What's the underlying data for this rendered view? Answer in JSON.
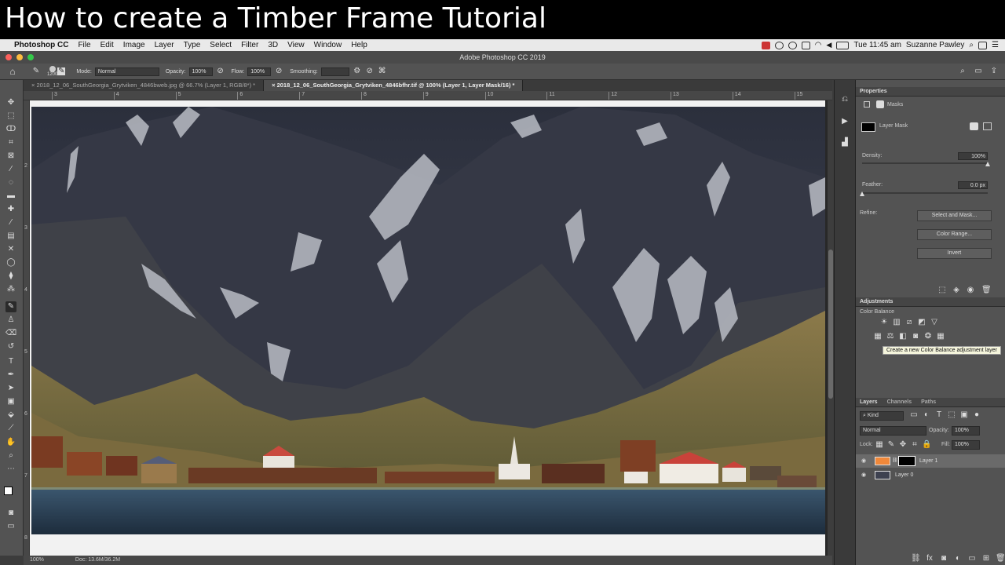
{
  "banner": {
    "title": "How to create a Timber Frame Tutorial"
  },
  "macbar": {
    "app": "Photoshop CC",
    "menus": [
      "File",
      "Edit",
      "Image",
      "Layer",
      "Type",
      "Select",
      "Filter",
      "3D",
      "View",
      "Window",
      "Help"
    ],
    "clock": "Tue 11:45 am",
    "user": "Suzanne Pawley"
  },
  "window": {
    "title": "Adobe Photoshop CC 2019"
  },
  "options": {
    "brush_size": "1200",
    "mode_label": "Mode:",
    "mode_value": "Normal",
    "opacity_label": "Opacity:",
    "opacity_value": "100%",
    "flow_label": "Flow:",
    "flow_value": "100%",
    "smoothing_label": "Smoothing:"
  },
  "tabs": [
    {
      "label": "2018_12_06_SouthGeorgia_Grytviken_4846bweb.jpg @ 66.7% (Layer 1, RGB/8*) *"
    },
    {
      "label": "2018_12_06_SouthGeorgia_Grytviken_4846bfhr.tif @ 100% (Layer 1, Layer Mask/16) *"
    }
  ],
  "ruler_top": [
    "3",
    "4",
    "5",
    "6",
    "7",
    "8",
    "9",
    "10",
    "11",
    "12",
    "13",
    "14",
    "15"
  ],
  "ruler_left": [
    "2",
    "3",
    "4",
    "5",
    "6",
    "7",
    "8"
  ],
  "status": {
    "zoom": "100%",
    "doc": "Doc: 13.6M/36.2M"
  },
  "properties": {
    "header": "Properties",
    "masks_label": "Masks",
    "layer_mask_label": "Layer Mask",
    "density_label": "Density:",
    "density_value": "100%",
    "density_fraction": 1.0,
    "feather_label": "Feather:",
    "feather_value": "0.0 px",
    "feather_fraction": 0.0,
    "refine_label": "Refine:",
    "select_mask_button": "Select and Mask...",
    "color_range_button": "Color Range...",
    "invert_button": "Invert"
  },
  "adjustments": {
    "header": "Adjustments",
    "subtitle": "Color Balance",
    "tooltip": "Create a new Color Balance adjustment layer"
  },
  "layers_panel": {
    "tabs": [
      "Layers",
      "Channels",
      "Paths"
    ],
    "kind_label": "Kind",
    "blend_mode": "Normal",
    "opacity_label": "Opacity:",
    "opacity_value": "100%",
    "lock_label": "Lock:",
    "fill_label": "Fill:",
    "fill_value": "100%",
    "layers": [
      {
        "name": "Layer 1",
        "thumb_color": "#f0883a",
        "selected": true
      },
      {
        "name": "Layer 0",
        "selected": false
      }
    ]
  },
  "colors": {
    "accent_layer": "#f0883a",
    "panel_bg": "#535353"
  }
}
